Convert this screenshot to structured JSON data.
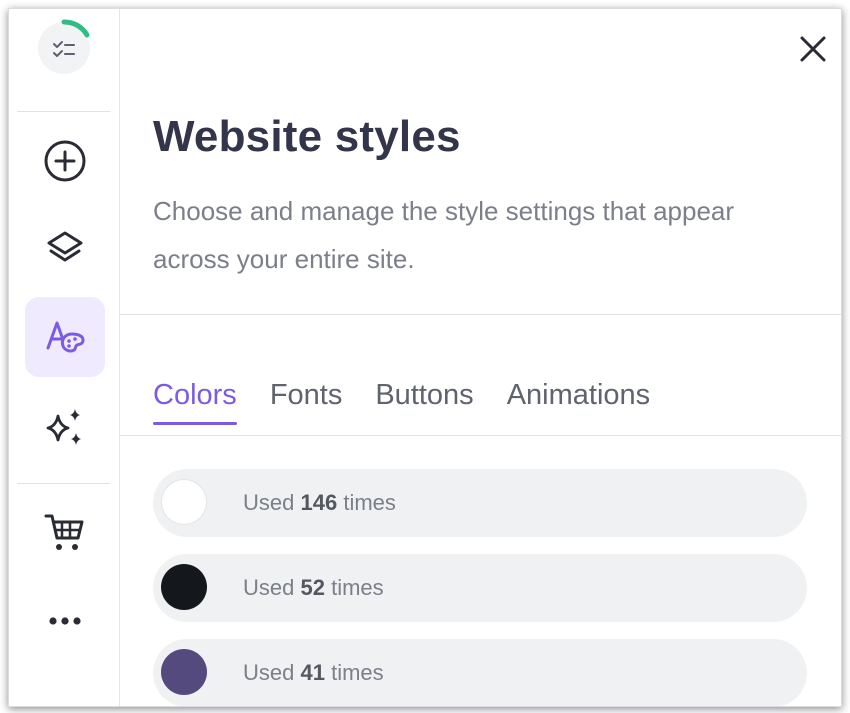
{
  "colors_theme": {
    "accent": "#7b5be3",
    "active_tab_bg": "#efeafe",
    "progress_ring": "#2ebd85"
  },
  "rail": {
    "items": [
      {
        "icon": "progress-checklist-icon"
      },
      {
        "icon": "add-circle-icon"
      },
      {
        "icon": "layers-icon"
      },
      {
        "icon": "styles-palette-icon",
        "active": true
      },
      {
        "icon": "sparkles-icon"
      },
      {
        "icon": "cart-icon"
      },
      {
        "icon": "more-icon"
      }
    ]
  },
  "panel": {
    "title": "Website styles",
    "description": "Choose and manage the style settings that appear across your entire site.",
    "close_icon": "close-icon"
  },
  "tabs": [
    {
      "label": "Colors",
      "active": true
    },
    {
      "label": "Fonts",
      "active": false
    },
    {
      "label": "Buttons",
      "active": false
    },
    {
      "label": "Animations",
      "active": false
    }
  ],
  "color_list": [
    {
      "color": "#ffffff",
      "prefix": "Used",
      "count": "146",
      "suffix": "times"
    },
    {
      "color": "#14171c",
      "prefix": "Used",
      "count": "52",
      "suffix": "times"
    },
    {
      "color": "#544a7e",
      "prefix": "Used",
      "count": "41",
      "suffix": "times"
    }
  ]
}
